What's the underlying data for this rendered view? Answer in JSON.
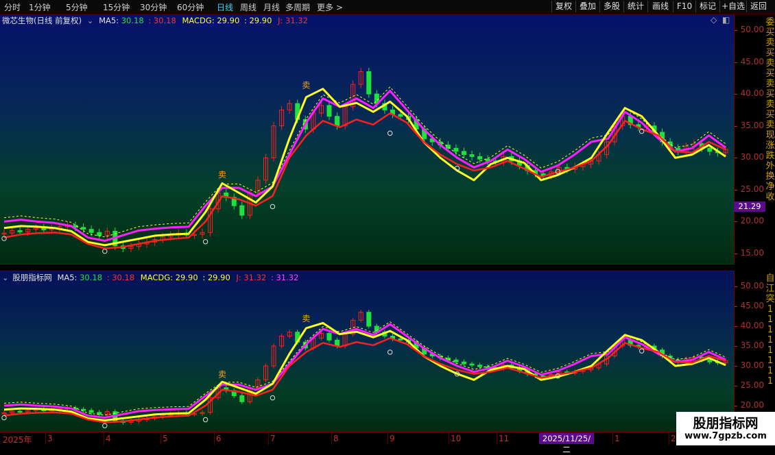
{
  "toolbar": {
    "periods": [
      "分时",
      "1分钟",
      "5分钟",
      "15分钟",
      "30分钟",
      "60分钟",
      "日线",
      "周线",
      "月线",
      "多周期",
      "更多"
    ],
    "active_period": "日线",
    "more_arrow": ">",
    "buttons": [
      "复权",
      "叠加",
      "多股",
      "统计",
      "画线",
      "F10",
      "标记",
      "+自选",
      "返回"
    ]
  },
  "panel1": {
    "title": "微芯生物(日线 前复权)",
    "ma5_label": "MA5:",
    "ma5_value": "30.18",
    "ma5_alt": ": 30.18",
    "macdg_label": "MACDG:",
    "macdg_value": "29.90",
    "macdg_alt": ": 29.90",
    "j_label": "J:",
    "j_value": "31.32",
    "axis_ticks": [
      "50.00",
      "45.00",
      "40.00",
      "35.00",
      "30.00",
      "25.00",
      "20.00",
      "15.00"
    ],
    "price_tag": "21.29",
    "icons": [
      "diamond-icon",
      "square-icon"
    ]
  },
  "panel2": {
    "title": "股朋指标网",
    "ma5_label": "MA5:",
    "ma5_value": "30.18",
    "ma5_alt": ": 30.18",
    "macdg_label": "MACDG:",
    "macdg_value": "29.90",
    "macdg_alt": ": 29.90",
    "j_label": "J:",
    "j_value": "31.32",
    "j_alt": ": 31.32",
    "axis_ticks": [
      "50.00",
      "45.00",
      "40.00",
      "35.00",
      "30.00",
      "25.00",
      "20.00"
    ]
  },
  "signals": {
    "sell": "卖"
  },
  "right_strip": {
    "top_chars": [
      "委",
      "买",
      "卖",
      "买",
      "卖",
      "买",
      "卖",
      "买",
      "卖",
      "买",
      "卖",
      "现",
      "涨",
      "跌",
      "外",
      "换",
      "净",
      "收"
    ],
    "bottom_chars": [
      "自",
      "江",
      "突",
      "1",
      "1",
      "1",
      "1",
      "1",
      "1",
      "1",
      "1"
    ]
  },
  "date_axis": {
    "labels": [
      "2025年",
      "3",
      "4",
      "5",
      "6",
      "7",
      "8",
      "9",
      "10",
      "11",
      "1",
      "2"
    ],
    "highlight": "2025/11/25/二"
  },
  "watermark": {
    "line1": "股朋指标网",
    "line2": "www.7gpzb.com"
  },
  "colors": {
    "up": "#ff2020",
    "down": "#20e040",
    "ma5": "#ffff20",
    "macdg": "#ff20ff",
    "j": "#ff2020",
    "axis": "#b03030",
    "active_tab": "#40d0ff"
  },
  "chart_data": {
    "type": "candlestick",
    "y_unit": "price",
    "ylim": [
      13,
      52
    ],
    "series": [
      {
        "name": "price",
        "values": [
          18.2,
          18.6,
          18.4,
          18.8,
          19.0,
          18.7,
          18.9,
          19.2,
          19.4,
          19.1,
          18.8,
          18.3,
          17.8,
          18.5,
          16.2,
          15.8,
          16.1,
          16.5,
          16.8,
          17.2,
          17.6,
          17.9,
          18.2,
          17.9,
          18.0,
          18.3,
          22.0,
          24.5,
          23.8,
          22.5,
          21.0,
          24.5,
          26.5,
          30.0,
          35.0,
          37.5,
          38.5,
          36.0,
          34.5,
          37.0,
          38.2,
          36.5,
          35.0,
          38.0,
          41.5,
          43.5,
          40.0,
          38.5,
          37.5,
          36.8,
          36.5,
          36.0,
          34.5,
          33.0,
          32.5,
          32.0,
          31.5,
          31.0,
          30.5,
          30.2,
          29.8,
          29.5,
          29.3,
          30.2,
          29.5,
          28.8,
          28.0,
          27.5,
          27.2,
          27.8,
          28.5,
          28.2,
          28.6,
          29.0,
          29.5,
          30.5,
          32.5,
          35.0,
          36.5,
          35.2,
          34.8,
          35.0,
          34.0,
          32.5,
          31.5,
          31.0,
          31.8,
          32.2,
          31.5,
          31.0,
          30.8,
          31.3
        ]
      },
      {
        "name": "MA5",
        "values": [
          19.0,
          19.3,
          19.2,
          19.0,
          18.5,
          16.8,
          16.3,
          16.8,
          17.3,
          17.8,
          18.0,
          18.1,
          21.5,
          26.0,
          24.5,
          23.0,
          25.5,
          33.0,
          39.5,
          40.8,
          38.0,
          38.6,
          37.2,
          38.8,
          36.5,
          32.5,
          30.0,
          28.0,
          26.5,
          29.0,
          30.0,
          29.2,
          26.5,
          27.3,
          28.5,
          30.0,
          34.0,
          37.8,
          36.5,
          33.5,
          30.0,
          30.5,
          32.0,
          30.2
        ]
      },
      {
        "name": "MACDG",
        "values": [
          20.0,
          20.3,
          20.0,
          19.8,
          19.3,
          17.5,
          17.0,
          17.8,
          18.6,
          18.9,
          19.1,
          19.2,
          22.5,
          25.3,
          25.3,
          24.0,
          25.5,
          30.5,
          35.5,
          39.3,
          38.0,
          39.3,
          37.8,
          40.5,
          37.5,
          34.5,
          32.0,
          30.0,
          28.5,
          29.5,
          31.3,
          29.8,
          27.8,
          28.8,
          30.5,
          32.5,
          33.0,
          37.2,
          35.5,
          33.0,
          31.0,
          31.5,
          33.5,
          31.6
        ]
      },
      {
        "name": "J",
        "values": [
          17.5,
          18.0,
          18.2,
          18.3,
          18.0,
          16.5,
          15.8,
          16.0,
          16.5,
          17.0,
          17.3,
          17.5,
          20.0,
          24.0,
          23.5,
          22.5,
          24.0,
          30.0,
          33.5,
          35.8,
          34.8,
          36.0,
          35.2,
          37.0,
          35.5,
          32.5,
          30.5,
          29.0,
          28.0,
          28.5,
          29.5,
          28.3,
          27.0,
          27.8,
          28.5,
          29.5,
          32.0,
          35.8,
          34.5,
          33.5,
          31.0,
          30.8,
          32.5,
          31.3
        ]
      }
    ]
  }
}
